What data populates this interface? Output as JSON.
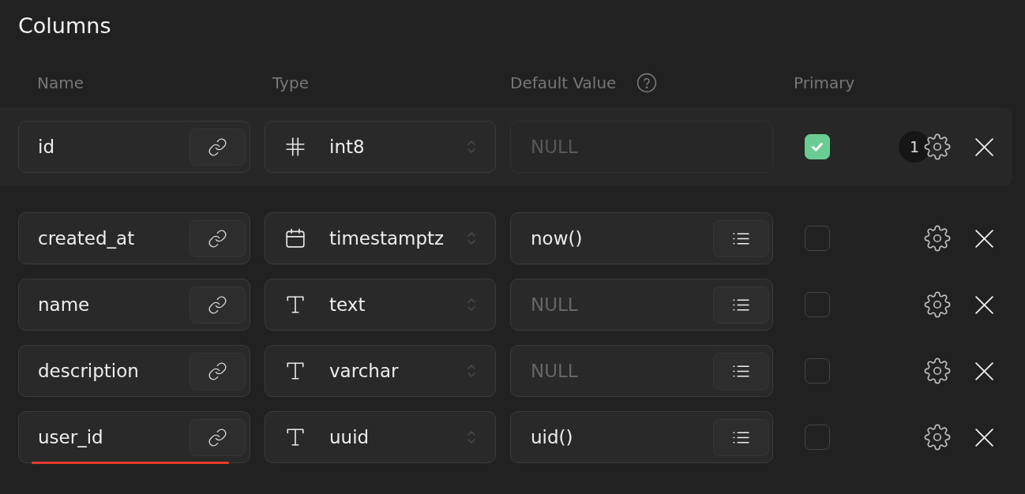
{
  "title": "Columns",
  "headers": [
    {
      "label": "Name",
      "help": false
    },
    {
      "label": "Type",
      "help": false
    },
    {
      "label": "Default Value",
      "help": true
    },
    {
      "label": "Primary",
      "help": false
    }
  ],
  "rows": [
    {
      "name": "id",
      "invalid": false,
      "type": "int8",
      "kind": "number",
      "default": {
        "placeholder": "NULL",
        "disabled": true
      },
      "primary": true,
      "badge": "1",
      "highlighted": true
    },
    {
      "name": "created_at",
      "invalid": false,
      "type": "timestamptz",
      "kind": "calendar",
      "default": {
        "value": "now()",
        "disabled": false
      },
      "primary": false,
      "highlighted": false
    },
    {
      "name": "name",
      "invalid": false,
      "type": "text",
      "kind": "text",
      "default": {
        "placeholder": "NULL",
        "disabled": false
      },
      "primary": false,
      "highlighted": false
    },
    {
      "name": "description",
      "invalid": false,
      "type": "varchar",
      "kind": "text",
      "default": {
        "placeholder": "NULL",
        "disabled": false
      },
      "primary": false,
      "highlighted": false
    },
    {
      "name": "user_id",
      "invalid": true,
      "type": "uuid",
      "kind": "text",
      "default": {
        "value": "uid()",
        "disabled": false
      },
      "primary": false,
      "highlighted": false
    }
  ]
}
